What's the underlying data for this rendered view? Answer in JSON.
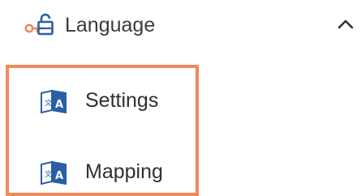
{
  "menu": {
    "parent": {
      "label": "Language",
      "icon": "language-key-icon",
      "expanded": true,
      "chevron_icon": "chevron-up-icon"
    },
    "children": [
      {
        "label": "Settings",
        "icon": "translate-book-icon"
      },
      {
        "label": "Mapping",
        "icon": "translate-book-icon"
      }
    ]
  },
  "colors": {
    "accent": "#f08a5d",
    "icon_blue": "#2a5fa8",
    "text": "#2f2f2f",
    "background": "#ffffff"
  }
}
